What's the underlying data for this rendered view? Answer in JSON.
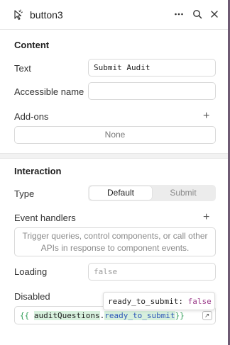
{
  "header": {
    "title": "button3",
    "icons": [
      "component-cursor-icon",
      "more-icon",
      "search-icon",
      "close-icon"
    ]
  },
  "content": {
    "section_title": "Content",
    "text_label": "Text",
    "text_value": "Submit Audit",
    "accessible_name_label": "Accessible name",
    "accessible_name_value": "",
    "addons_label": "Add-ons",
    "addons_none": "None"
  },
  "interaction": {
    "section_title": "Interaction",
    "type_label": "Type",
    "type_options": [
      "Default",
      "Submit"
    ],
    "type_selected": "Default",
    "event_handlers_label": "Event handlers",
    "event_handlers_help": "Trigger queries, control components, or call other APIs in response to component events.",
    "loading_label": "Loading",
    "loading_placeholder": "false",
    "disabled_label": "Disabled",
    "disabled_code": {
      "open": "{{",
      "object": "auditQuestions",
      "dot": ".",
      "property": "ready_to_submit",
      "close": "}}"
    },
    "tooltip": {
      "key": "ready_to_submit:",
      "value": "false"
    }
  },
  "colors": {
    "code_brace": "#2d9c55",
    "code_property": "#2d56b8",
    "tooltip_value": "#9b3c8a",
    "edge": "#6e5a73"
  }
}
